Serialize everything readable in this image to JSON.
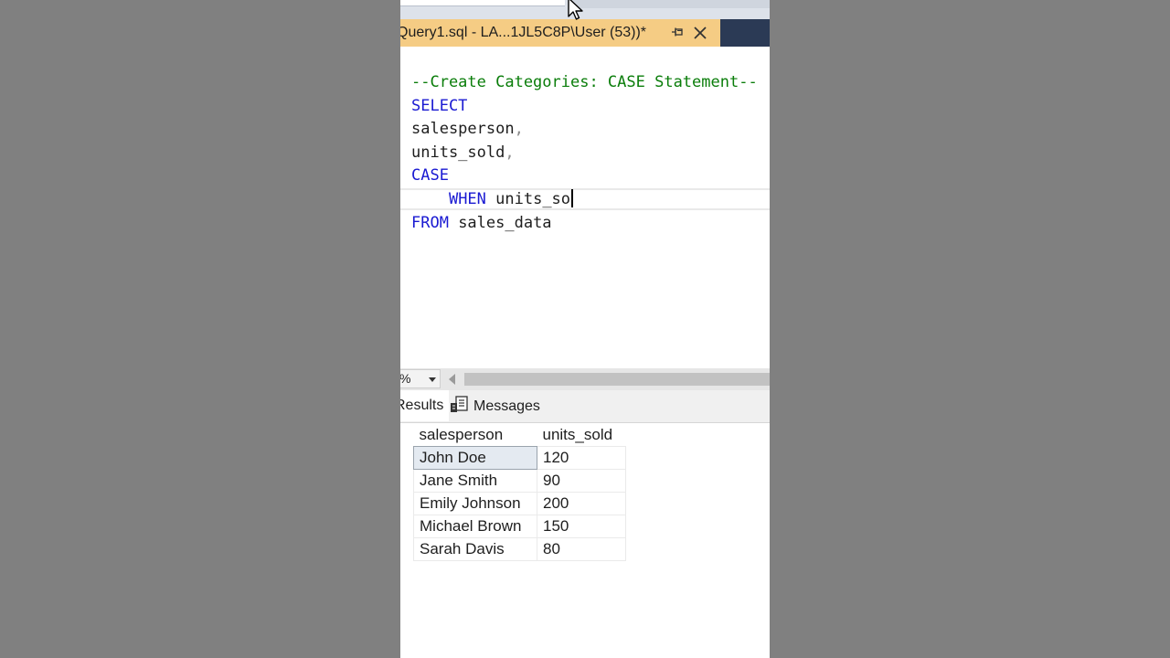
{
  "document_tab": {
    "title": "Query1.sql - LA...1JL5C8P\\User (53))*",
    "pin_icon": "pin-icon",
    "close_icon": "close-icon"
  },
  "editor": {
    "lines": [
      {
        "parts": [
          {
            "t": "--Create Categories: CASE Statement--",
            "c": "cm"
          }
        ]
      },
      {
        "parts": [
          {
            "t": "SELECT",
            "c": "kw"
          }
        ]
      },
      {
        "parts": [
          {
            "t": "salesperson",
            "c": ""
          },
          {
            "t": ",",
            "c": "pu"
          }
        ]
      },
      {
        "parts": [
          {
            "t": "units_sold",
            "c": ""
          },
          {
            "t": ",",
            "c": "pu"
          }
        ]
      },
      {
        "parts": [
          {
            "t": "CASE",
            "c": "kw"
          }
        ]
      },
      {
        "parts": [
          {
            "t": "    ",
            "c": ""
          },
          {
            "t": "WHEN",
            "c": "kw"
          },
          {
            "t": " units_so",
            "c": ""
          }
        ],
        "current": true
      },
      {
        "parts": [
          {
            "t": "FROM",
            "c": "kw"
          },
          {
            "t": " sales_data",
            "c": ""
          }
        ]
      }
    ]
  },
  "zoom": {
    "value": "%"
  },
  "results_tabs": {
    "results_label": "Results",
    "messages_label": "Messages"
  },
  "grid": {
    "columns": [
      "salesperson",
      "units_sold"
    ],
    "rows": [
      [
        "John Doe",
        "120"
      ],
      [
        "Jane Smith",
        "90"
      ],
      [
        "Emily Johnson",
        "200"
      ],
      [
        "Michael Brown",
        "150"
      ],
      [
        "Sarah Davis",
        "80"
      ]
    ]
  },
  "colors": {
    "tab_active": "#f5cc84",
    "tab_strip": "#2b3a55",
    "keyword": "#1a1ad2",
    "comment": "#0a7d0a"
  }
}
